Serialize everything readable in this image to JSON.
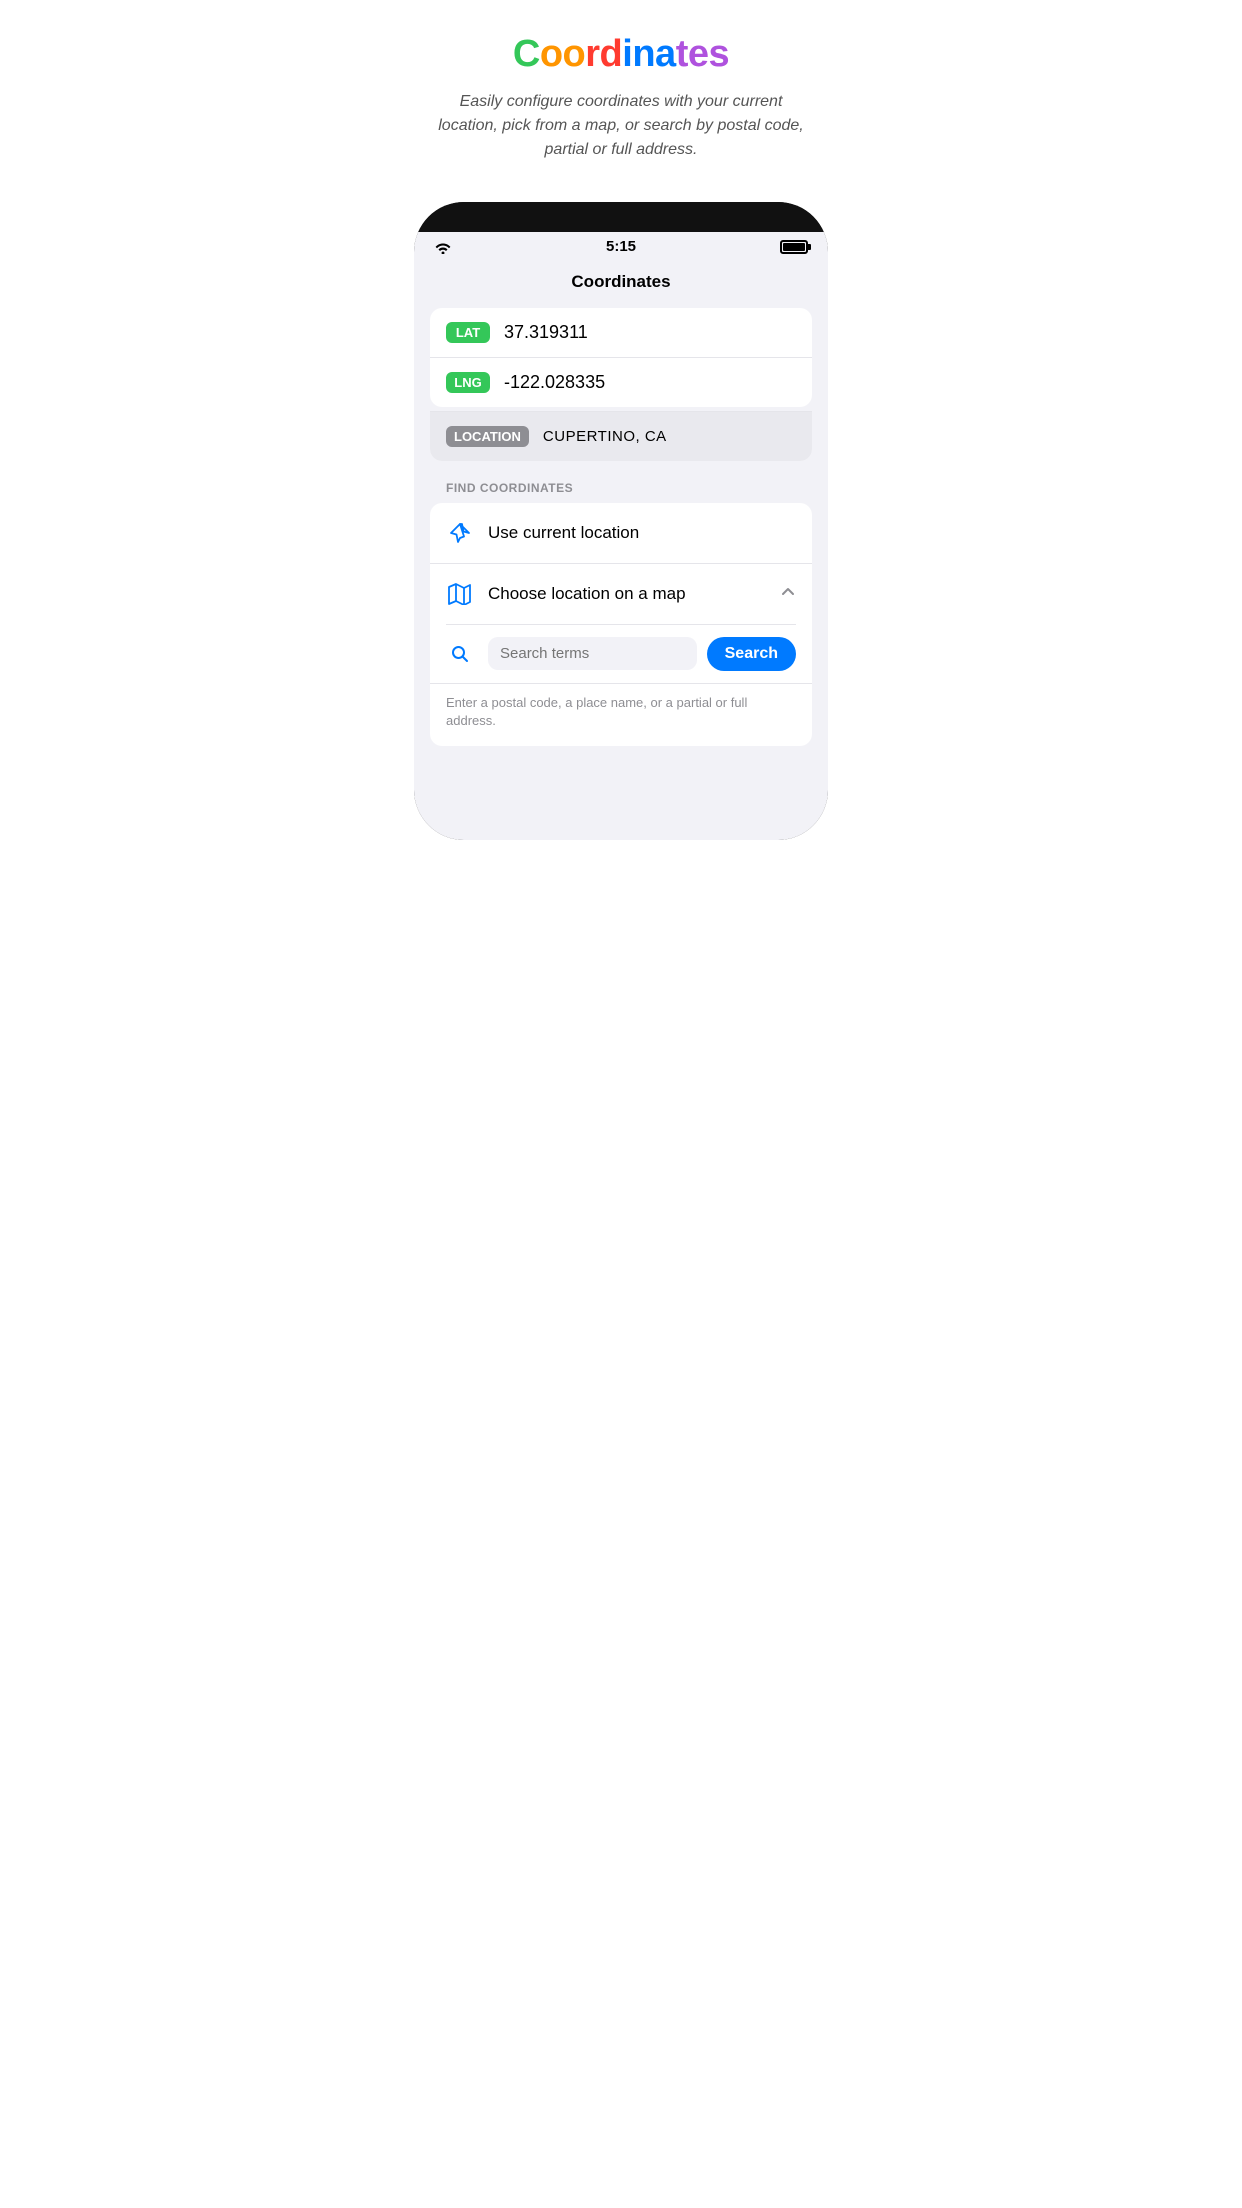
{
  "page": {
    "appTitle": "Coordinates",
    "appTitleColors": [
      {
        "char": "C",
        "color": "#34c759"
      },
      {
        "char": "o",
        "color": "#ff9500"
      },
      {
        "char": "o",
        "color": "#ff3b30"
      },
      {
        "char": "r",
        "color": "#ff3b30"
      },
      {
        "char": "d",
        "color": "#007aff"
      },
      {
        "char": "i",
        "color": "#007aff"
      },
      {
        "char": "n",
        "color": "#007aff"
      },
      {
        "char": "a",
        "color": "#af52de"
      },
      {
        "char": "t",
        "color": "#af52de"
      },
      {
        "char": "e",
        "color": "#af52de"
      },
      {
        "char": "s",
        "color": "#af52de"
      }
    ],
    "subtitle": "Easily configure coordinates with your current location, pick from a map, or search by postal code, partial or full address.",
    "statusBar": {
      "time": "5:15",
      "wifi": true,
      "battery": "full"
    },
    "navTitle": "Coordinates",
    "coordinates": {
      "lat": {
        "label": "LAT",
        "value": "37.319311"
      },
      "lng": {
        "label": "LNG",
        "value": "-122.028335"
      },
      "location": {
        "label": "LOCATION",
        "value": "CUPERTINO, CA"
      }
    },
    "findSection": {
      "header": "FIND COORDINATES",
      "useCurrentLocation": {
        "label": "Use current location"
      },
      "chooseOnMap": {
        "label": "Choose location on a map"
      },
      "search": {
        "placeholder": "Search terms",
        "buttonLabel": "Search",
        "hint": "Enter a postal code, a place name, or a partial or full address."
      }
    }
  }
}
